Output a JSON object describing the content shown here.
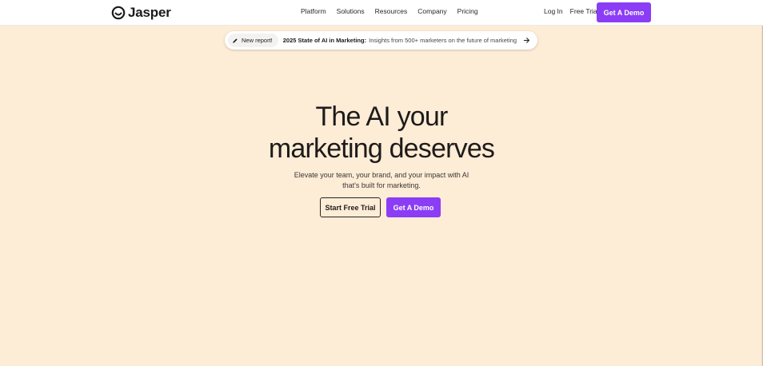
{
  "brand": {
    "name": "Jasper",
    "accent": "#8b3df5",
    "background": "#fdecd6",
    "logo_icon": "jasper-face-icon"
  },
  "nav": {
    "items": [
      "Platform",
      "Solutions",
      "Resources",
      "Company",
      "Pricing"
    ],
    "login": "Log In",
    "free_trial": "Free Trial",
    "demo": "Get A Demo"
  },
  "banner": {
    "pill_icon": "pen-icon",
    "pill": "New report!",
    "bold": "2025 State of AI in Marketing:",
    "text": "Insights from 500+ marketers on the future of marketing",
    "arrow_icon": "arrow-right-icon"
  },
  "hero": {
    "title_line1": "The AI your",
    "title_line2": "marketing deserves",
    "sub_line1": "Elevate your team, your brand, and your impact with AI",
    "sub_line2": "that's built for marketing.",
    "trial_button": "Start Free Trial",
    "demo_button": "Get A Demo"
  }
}
